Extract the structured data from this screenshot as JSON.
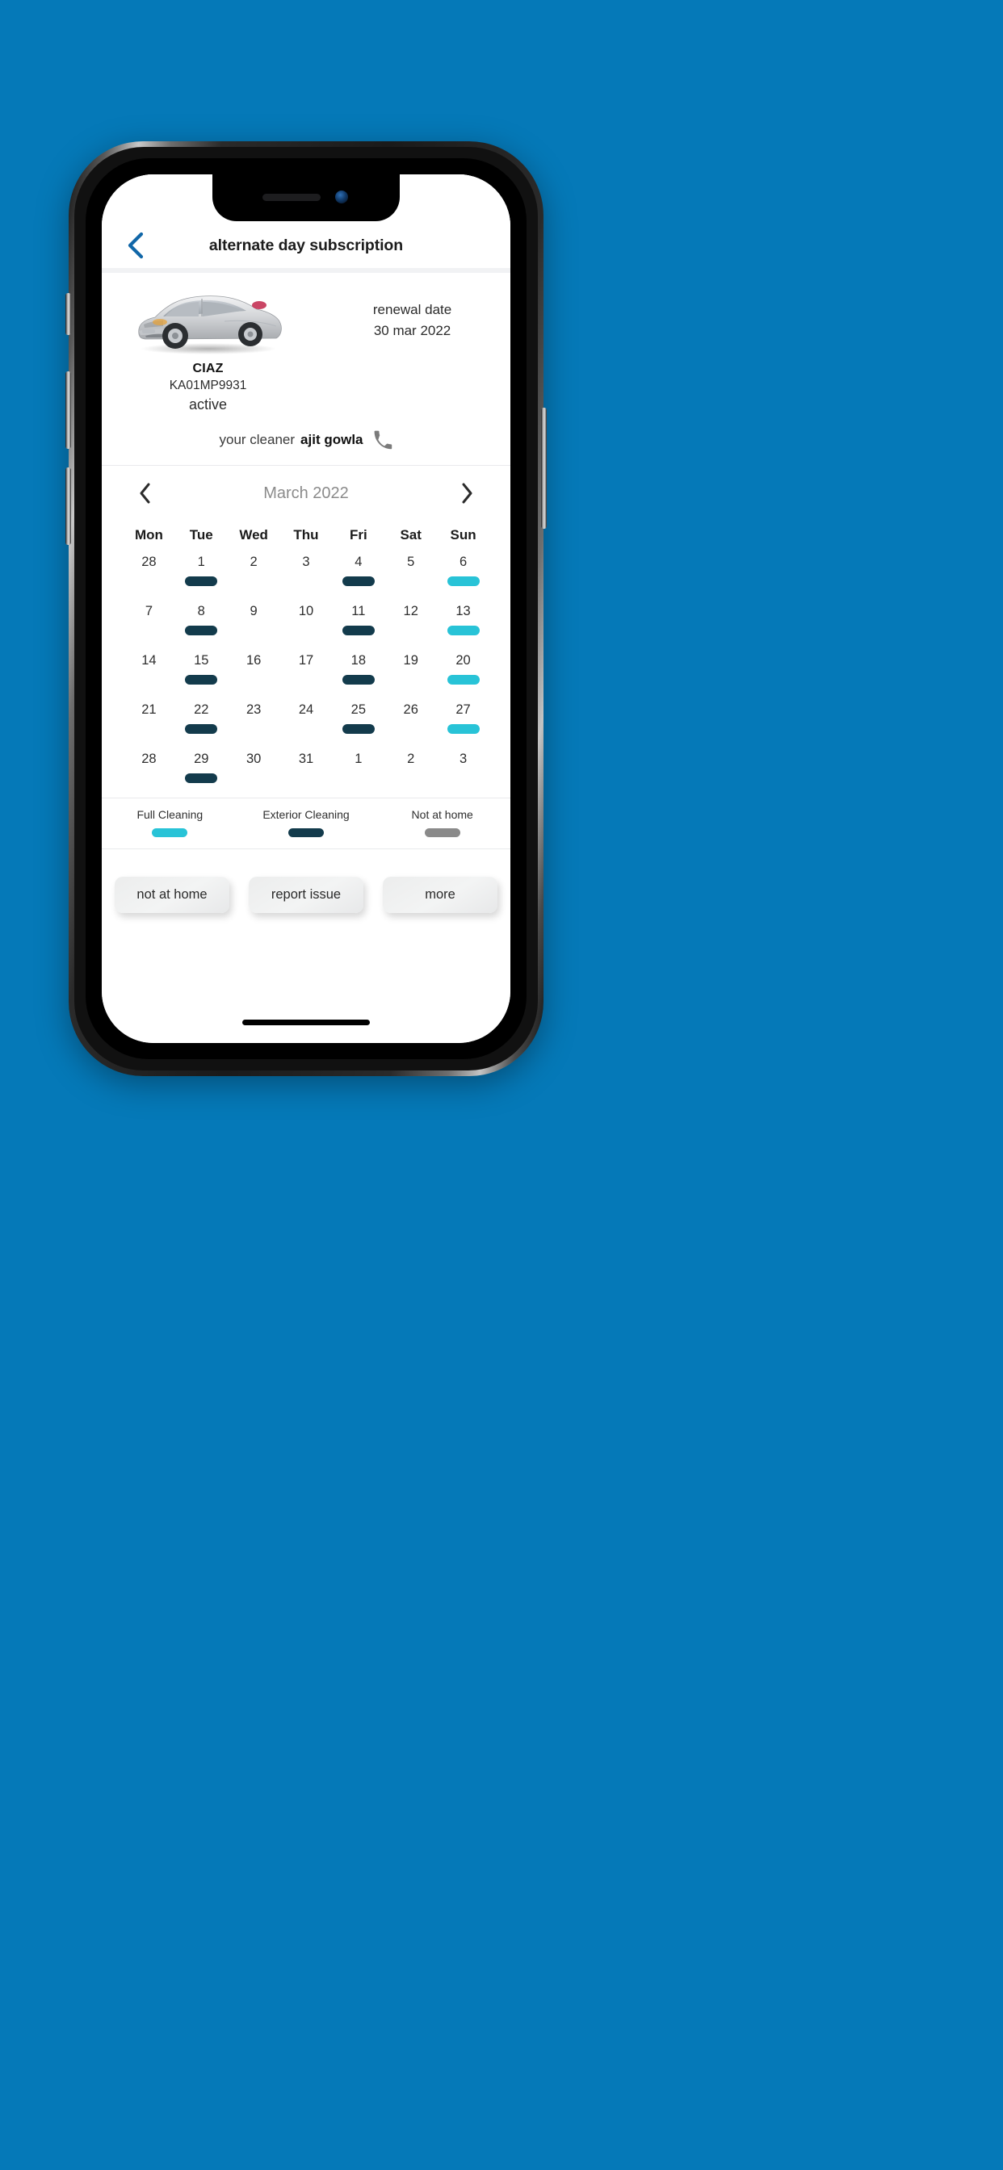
{
  "theme": {
    "background": "#0579b8",
    "accent_blue": "#1167a8",
    "full_cleaning_color": "#28c3d7",
    "exterior_cleaning_color": "#133b4c",
    "not_at_home_color": "#8a8a8a"
  },
  "appbar": {
    "title": "alternate day subscription",
    "back_icon": "chevron-left-icon"
  },
  "vehicle": {
    "image_alt": "silver sedan car",
    "name": "CIAZ",
    "plate": "KA01MP9931",
    "status": "active",
    "renewal_label": "renewal date",
    "renewal_date": "30 mar 2022"
  },
  "cleaner": {
    "label": "your cleaner",
    "name": "ajit gowla",
    "call_icon": "phone-icon"
  },
  "calendar": {
    "month_label": "March 2022",
    "prev_icon": "chevron-left-icon",
    "next_icon": "chevron-right-icon",
    "weekdays": [
      "Mon",
      "Tue",
      "Wed",
      "Thu",
      "Fri",
      "Sat",
      "Sun"
    ],
    "days": [
      {
        "num": "28",
        "type": "none",
        "other_month": true
      },
      {
        "num": "1",
        "type": "exterior",
        "other_month": false
      },
      {
        "num": "2",
        "type": "none",
        "other_month": false
      },
      {
        "num": "3",
        "type": "none",
        "other_month": false
      },
      {
        "num": "4",
        "type": "exterior",
        "other_month": false
      },
      {
        "num": "5",
        "type": "none",
        "other_month": false
      },
      {
        "num": "6",
        "type": "full",
        "other_month": false
      },
      {
        "num": "7",
        "type": "none",
        "other_month": false
      },
      {
        "num": "8",
        "type": "exterior",
        "other_month": false
      },
      {
        "num": "9",
        "type": "none",
        "other_month": false
      },
      {
        "num": "10",
        "type": "none",
        "other_month": false
      },
      {
        "num": "11",
        "type": "exterior",
        "other_month": false
      },
      {
        "num": "12",
        "type": "none",
        "other_month": false
      },
      {
        "num": "13",
        "type": "full",
        "other_month": false
      },
      {
        "num": "14",
        "type": "none",
        "other_month": false
      },
      {
        "num": "15",
        "type": "exterior",
        "other_month": false
      },
      {
        "num": "16",
        "type": "none",
        "other_month": false
      },
      {
        "num": "17",
        "type": "none",
        "other_month": false
      },
      {
        "num": "18",
        "type": "exterior",
        "other_month": false
      },
      {
        "num": "19",
        "type": "none",
        "other_month": false
      },
      {
        "num": "20",
        "type": "full",
        "other_month": false
      },
      {
        "num": "21",
        "type": "none",
        "other_month": false
      },
      {
        "num": "22",
        "type": "exterior",
        "other_month": false
      },
      {
        "num": "23",
        "type": "none",
        "other_month": false
      },
      {
        "num": "24",
        "type": "none",
        "other_month": false
      },
      {
        "num": "25",
        "type": "exterior",
        "other_month": false
      },
      {
        "num": "26",
        "type": "none",
        "other_month": false
      },
      {
        "num": "27",
        "type": "full",
        "other_month": false
      },
      {
        "num": "28",
        "type": "none",
        "other_month": false
      },
      {
        "num": "29",
        "type": "exterior",
        "other_month": false
      },
      {
        "num": "30",
        "type": "none",
        "other_month": false
      },
      {
        "num": "31",
        "type": "none",
        "other_month": false
      },
      {
        "num": "1",
        "type": "none",
        "other_month": true
      },
      {
        "num": "2",
        "type": "none",
        "other_month": true
      },
      {
        "num": "3",
        "type": "none",
        "other_month": true
      }
    ]
  },
  "legend": [
    {
      "label": "Full Cleaning",
      "color": "#28c3d7"
    },
    {
      "label": "Exterior Cleaning",
      "color": "#133b4c"
    },
    {
      "label": "Not at home",
      "color": "#8a8a8a"
    }
  ],
  "actions": [
    {
      "label": "not at home"
    },
    {
      "label": "report issue"
    },
    {
      "label": "more"
    }
  ]
}
